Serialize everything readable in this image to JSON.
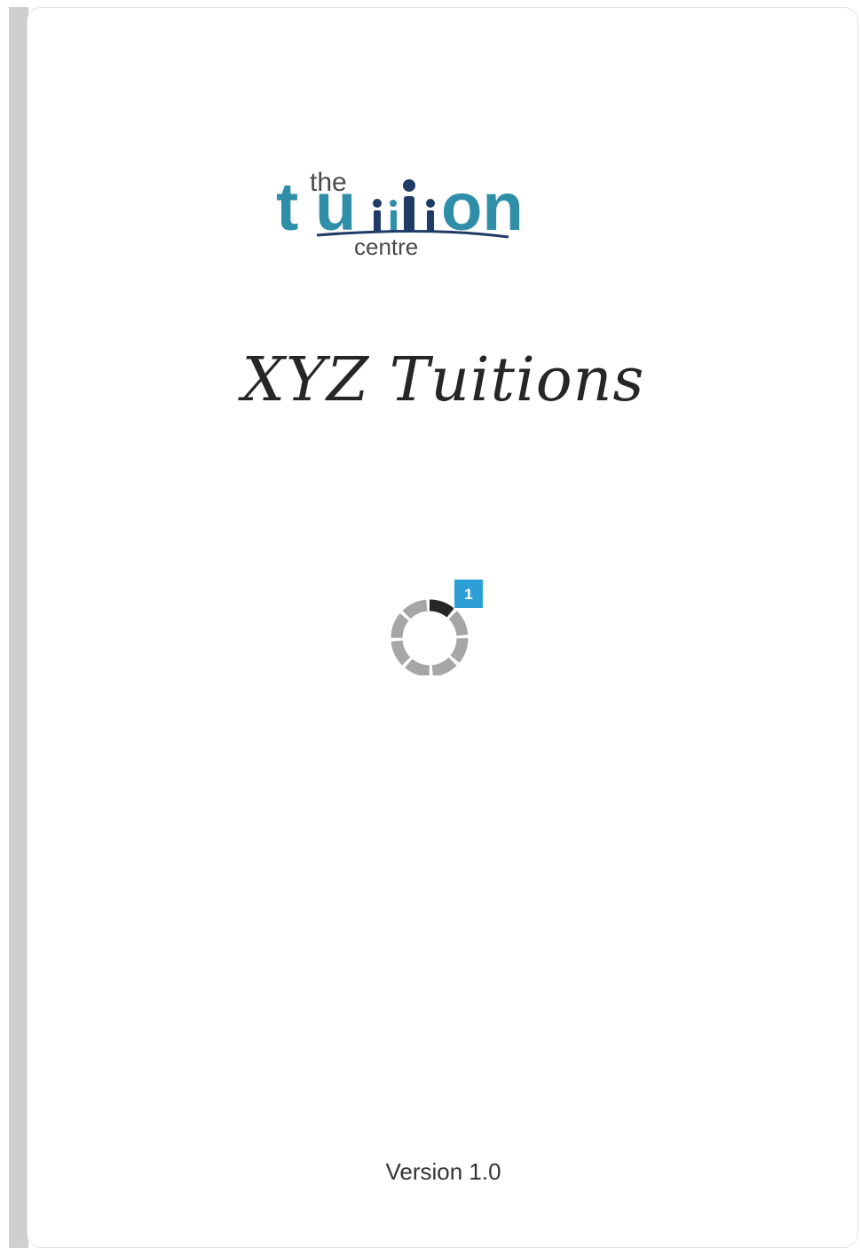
{
  "logo": {
    "word_top": "the",
    "word_main": "tuition",
    "word_bottom": "centre",
    "colors": {
      "brand_teal": "#2f8ea8",
      "brand_navy": "#1f3b66",
      "text_gray": "#4a4a4a"
    }
  },
  "app": {
    "title": "XYZ Tuitions",
    "version_label": "Version 1.0"
  },
  "loader": {
    "icon": "loading-spinner-icon",
    "badge_value": "1",
    "badge_color": "#2e9fd6",
    "segment_color": "#a6a6a6",
    "active_segment_color": "#262626"
  }
}
